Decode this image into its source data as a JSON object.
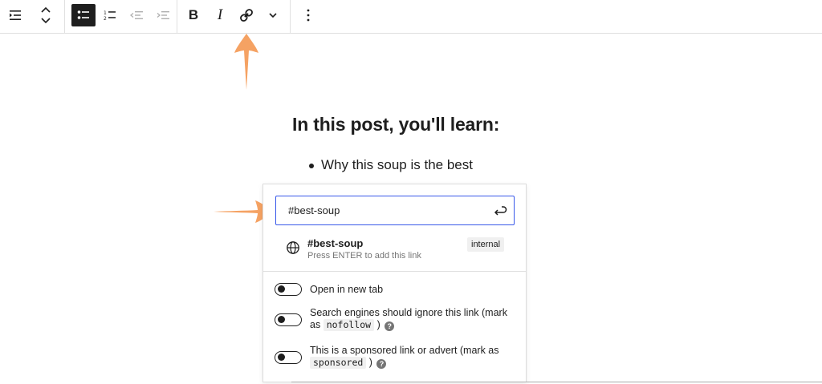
{
  "toolbar": {
    "bold_label": "B",
    "italic_label": "I"
  },
  "content": {
    "heading": "In this post, you'll learn:",
    "list_items": [
      "Why this soup is the best"
    ]
  },
  "link_popover": {
    "url_value": "#best-soup",
    "suggestion": {
      "title": "#best-soup",
      "hint": "Press ENTER to add this link",
      "badge": "internal"
    },
    "options": {
      "new_tab": "Open in new tab",
      "nofollow_before": "Search engines should ignore this link (mark as",
      "nofollow_code": "nofollow",
      "nofollow_after": ")",
      "sponsored_before": "This is a sponsored link or advert (mark as",
      "sponsored_code": "sponsored",
      "sponsored_after": ")",
      "help_glyph": "?"
    }
  },
  "colors": {
    "accent": "#3858e9",
    "arrow": "#f5a263",
    "text": "#1e1e1e"
  }
}
